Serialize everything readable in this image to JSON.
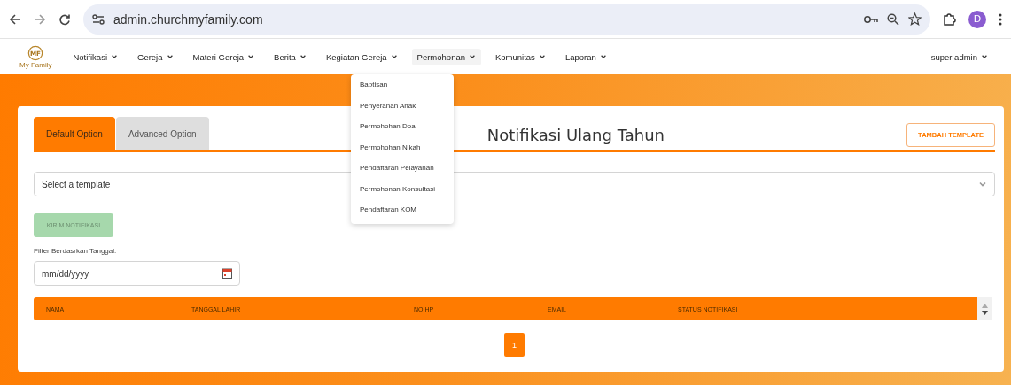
{
  "browser": {
    "url": "admin.churchmyfamily.com",
    "avatar": "D"
  },
  "logo": {
    "letters": "MF",
    "caption": "My Family"
  },
  "nav": {
    "items": [
      {
        "label": "Notifikasi",
        "expanded": false
      },
      {
        "label": "Gereja",
        "expanded": false
      },
      {
        "label": "Materi Gereja",
        "expanded": false
      },
      {
        "label": "Berita",
        "expanded": false
      },
      {
        "label": "Kegiatan Gereja",
        "expanded": false
      },
      {
        "label": "Permohonan",
        "expanded": true
      },
      {
        "label": "Komunitas",
        "expanded": false
      },
      {
        "label": "Laporan",
        "expanded": false
      }
    ],
    "user": "super admin"
  },
  "dropdown": {
    "items": [
      "Baptisan",
      "Penyerahan Anak",
      "Permohohan Doa",
      "Permohohan Nikah",
      "Pendaftaran Pelayanan",
      "Permohonan Konsultasi",
      "Pendaftaran KOM"
    ]
  },
  "tabs": [
    {
      "label": "Default Option",
      "selected": true
    },
    {
      "label": "Advanced Option",
      "selected": false
    }
  ],
  "title": "Notifikasi Ulang Tahun",
  "add_button": "TAMBAH TEMPLATE",
  "template_select": {
    "placeholder": "Select a template"
  },
  "send_button": {
    "label": "KIRIM NOTIFIKASI",
    "disabled": true
  },
  "date_filter": {
    "label": "Filter Berdasrkan Tanggal:",
    "placeholder": "mm/dd/yyyy"
  },
  "table": {
    "columns": [
      "NAMA",
      "TANGGAL LAHIR",
      "NO HP",
      "EMAIL",
      "STATUS NOTIFIKASI"
    ]
  },
  "pagination": [
    {
      "label": "1",
      "selected": true
    }
  ]
}
